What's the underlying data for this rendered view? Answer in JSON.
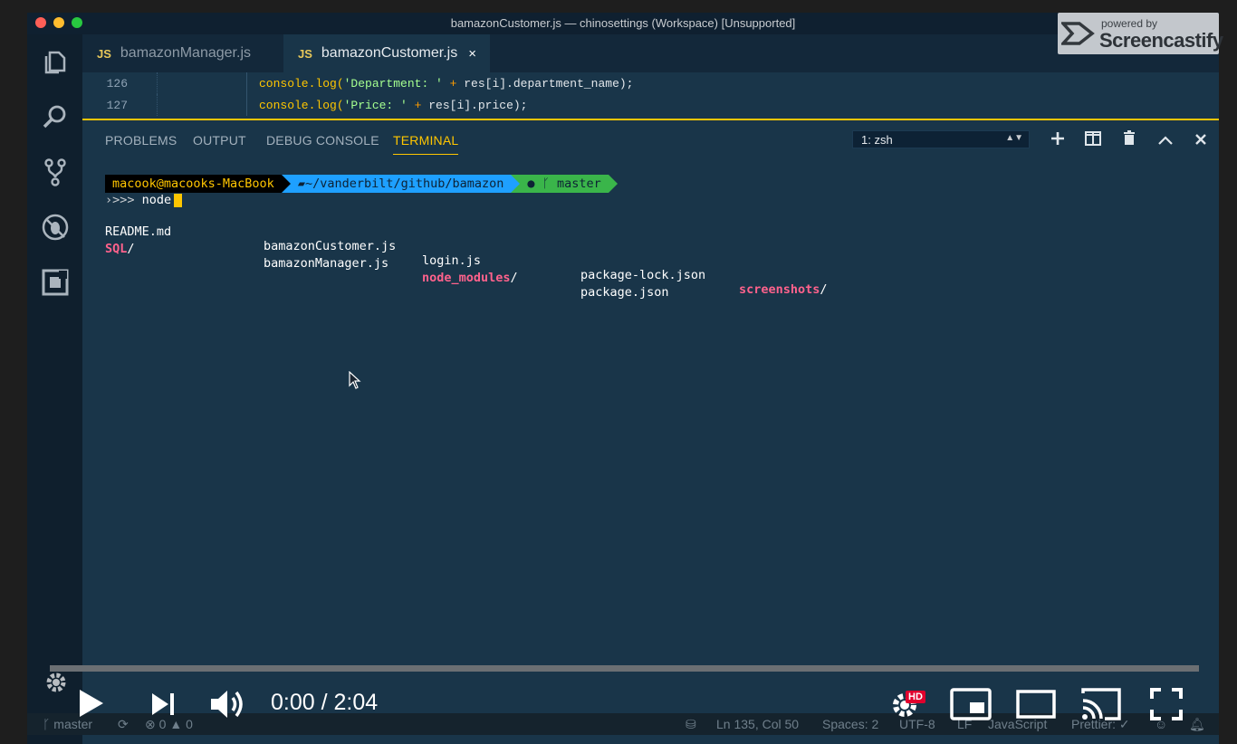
{
  "window": {
    "title": "bamazonCustomer.js — chinosettings (Workspace) [Unsupported]"
  },
  "activity_bar": {
    "icons": [
      "files-icon",
      "search-icon",
      "source-control-icon",
      "debug-icon",
      "extensions-icon",
      "gear-icon"
    ]
  },
  "tabs": [
    {
      "badge": "JS",
      "label": "bamazonManager.js",
      "active": false
    },
    {
      "badge": "JS",
      "label": "bamazonCustomer.js",
      "active": true,
      "close": "×"
    }
  ],
  "editor": {
    "lines": [
      {
        "number": "126",
        "fn": "console.log(",
        "str": "'Department: '",
        "op": " + ",
        "rest": "res[i].department_name);"
      },
      {
        "number": "127",
        "fn": "console.log(",
        "str": "'Price: '",
        "op": " + ",
        "rest": "res[i].price);"
      }
    ]
  },
  "panel": {
    "tabs": [
      "PROBLEMS",
      "OUTPUT",
      "DEBUG CONSOLE",
      "TERMINAL"
    ],
    "active_tab": "TERMINAL",
    "terminal_select": "1: zsh"
  },
  "terminal": {
    "prompt_user": "macook@macooks-MacBook",
    "prompt_path": "~/vanderbilt/github/bamazon",
    "prompt_branch": "master",
    "command_prefix": "›>>> ",
    "command": "node",
    "listing": [
      [
        {
          "name": "README.md",
          "dir": false
        },
        {
          "name": "bamazonCustomer.js",
          "dir": false
        },
        {
          "name": "login.js",
          "dir": false
        },
        {
          "name": "package-lock.json",
          "dir": false
        },
        {
          "name": "screenshots",
          "dir": true
        }
      ],
      [
        {
          "name": "SQL",
          "dir": true
        },
        {
          "name": "bamazonManager.js",
          "dir": false
        },
        {
          "name": "node_modules",
          "dir": true
        },
        {
          "name": "package.json",
          "dir": false
        }
      ]
    ]
  },
  "watermark": {
    "small": "powered by",
    "big": "Screencastify"
  },
  "status_bar": {
    "branch": "master",
    "errors": "0",
    "warnings": "0",
    "position": "Ln 135, Col 50",
    "spaces": "Spaces: 2",
    "encoding": "UTF-8",
    "eol": "LF",
    "language": "JavaScript",
    "prettier": "Prettier: ✓"
  },
  "video": {
    "time": "0:00 / 2:04",
    "progress": 0,
    "quality_badge": "HD"
  }
}
